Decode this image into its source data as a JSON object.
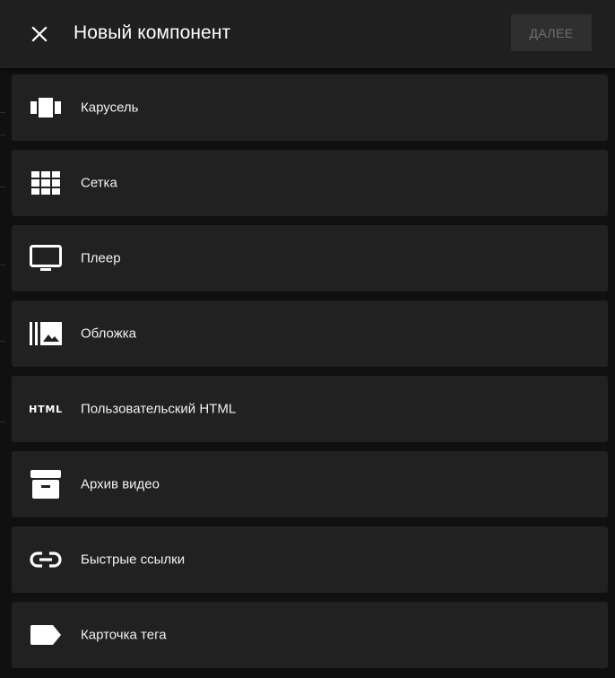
{
  "header": {
    "title": "Новый компонент",
    "next_label": "ДАЛЕЕ",
    "close_icon": "close-icon"
  },
  "items": [
    {
      "label": "Карусель",
      "icon": "carousel-icon"
    },
    {
      "label": "Сетка",
      "icon": "grid-icon"
    },
    {
      "label": "Плеер",
      "icon": "player-icon"
    },
    {
      "label": "Обложка",
      "icon": "cover-icon"
    },
    {
      "label": "Пользовательский HTML",
      "icon": "html-icon",
      "icon_text": "HTML"
    },
    {
      "label": "Архив видео",
      "icon": "archive-icon"
    },
    {
      "label": "Быстрые ссылки",
      "icon": "link-icon"
    },
    {
      "label": "Карточка тега",
      "icon": "tag-icon"
    }
  ],
  "colors": {
    "header_bg": "#1f1f1f",
    "item_bg": "#212121",
    "page_bg": "#101010",
    "disabled_button_bg": "#2f2f2f",
    "disabled_button_text": "#6f6f6f"
  }
}
